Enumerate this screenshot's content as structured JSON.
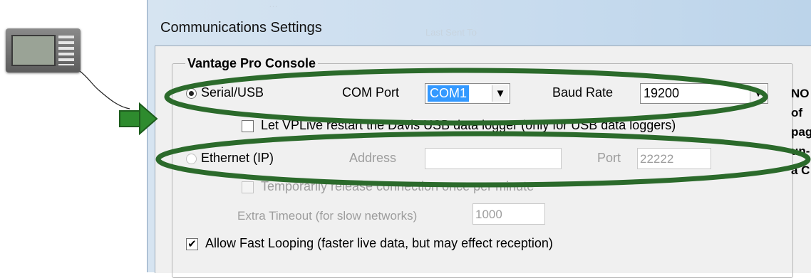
{
  "window": {
    "title": "Communications Settings",
    "ghost_top": "…",
    "ghost_mid": "Last Sent To"
  },
  "group": {
    "title": "Vantage Pro Console"
  },
  "serial": {
    "label": "Serial/USB",
    "com_port_label": "COM Port",
    "com_port_value": "COM1",
    "baud_label": "Baud Rate",
    "baud_value": "19200",
    "selected": true
  },
  "restart_logger": {
    "label": "Let VPLive restart the Davis USB data logger (only for USB data loggers)",
    "checked": false
  },
  "ethernet": {
    "label": "Ethernet (IP)",
    "address_label": "Address",
    "address_value": "",
    "port_label": "Port",
    "port_value": "22222",
    "selected": false
  },
  "temp_release": {
    "label": "Temporarily release  connection once per minute",
    "checked": false
  },
  "extra_timeout": {
    "label": "Extra Timeout (for slow networks)",
    "value": "1000"
  },
  "fast_looping": {
    "label": "Allow Fast Looping (faster live data, but may effect reception)",
    "checked": true,
    "check_glyph": "✔"
  },
  "right_fragment": {
    "l1": "NO",
    "l2": "of",
    "l3": "pag",
    "l4": "un-",
    "l5": "a C"
  },
  "colors": {
    "annotation_green": "#2b6a2b",
    "arrow_green": "#2e8b2e",
    "selection_blue": "#3399ff"
  },
  "icons": {
    "device": "weather-console-icon",
    "arrow": "right-arrow-icon"
  }
}
